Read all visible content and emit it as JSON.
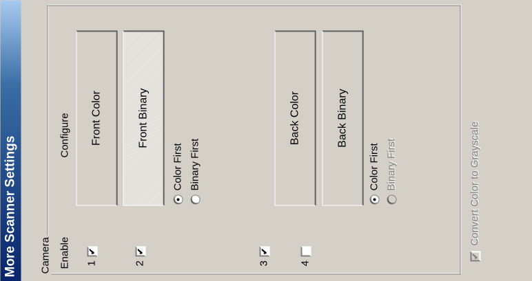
{
  "window": {
    "title": "More Scanner Settings"
  },
  "camera": {
    "group_label": "Camera",
    "headers": {
      "enable": "Enable",
      "configure": "Configure"
    },
    "rows": [
      {
        "num": "1",
        "checked": true,
        "checkmark": "✔",
        "button": "Front Color"
      },
      {
        "num": "2",
        "checked": true,
        "checkmark": "✔",
        "button": "Front Binary"
      },
      {
        "num": "3",
        "checked": true,
        "checkmark": "✔",
        "button": "Back Color"
      },
      {
        "num": "4",
        "checked": false,
        "checkmark": "",
        "button": "Back Binary"
      }
    ],
    "front_order": {
      "color_first": "Color First",
      "binary_first": "Binary First",
      "selected": "color_first"
    },
    "back_order": {
      "color_first": "Color First",
      "binary_first": "Binary First",
      "selected": "color_first",
      "binary_disabled": true
    }
  },
  "convert": {
    "label": "Convert Color to Grayscale",
    "checked": true,
    "disabled": true,
    "checkmark": "✔"
  },
  "colors": {
    "title_start": "#08246b",
    "title_end": "#a6caf0",
    "face": "#d4d0c8"
  }
}
